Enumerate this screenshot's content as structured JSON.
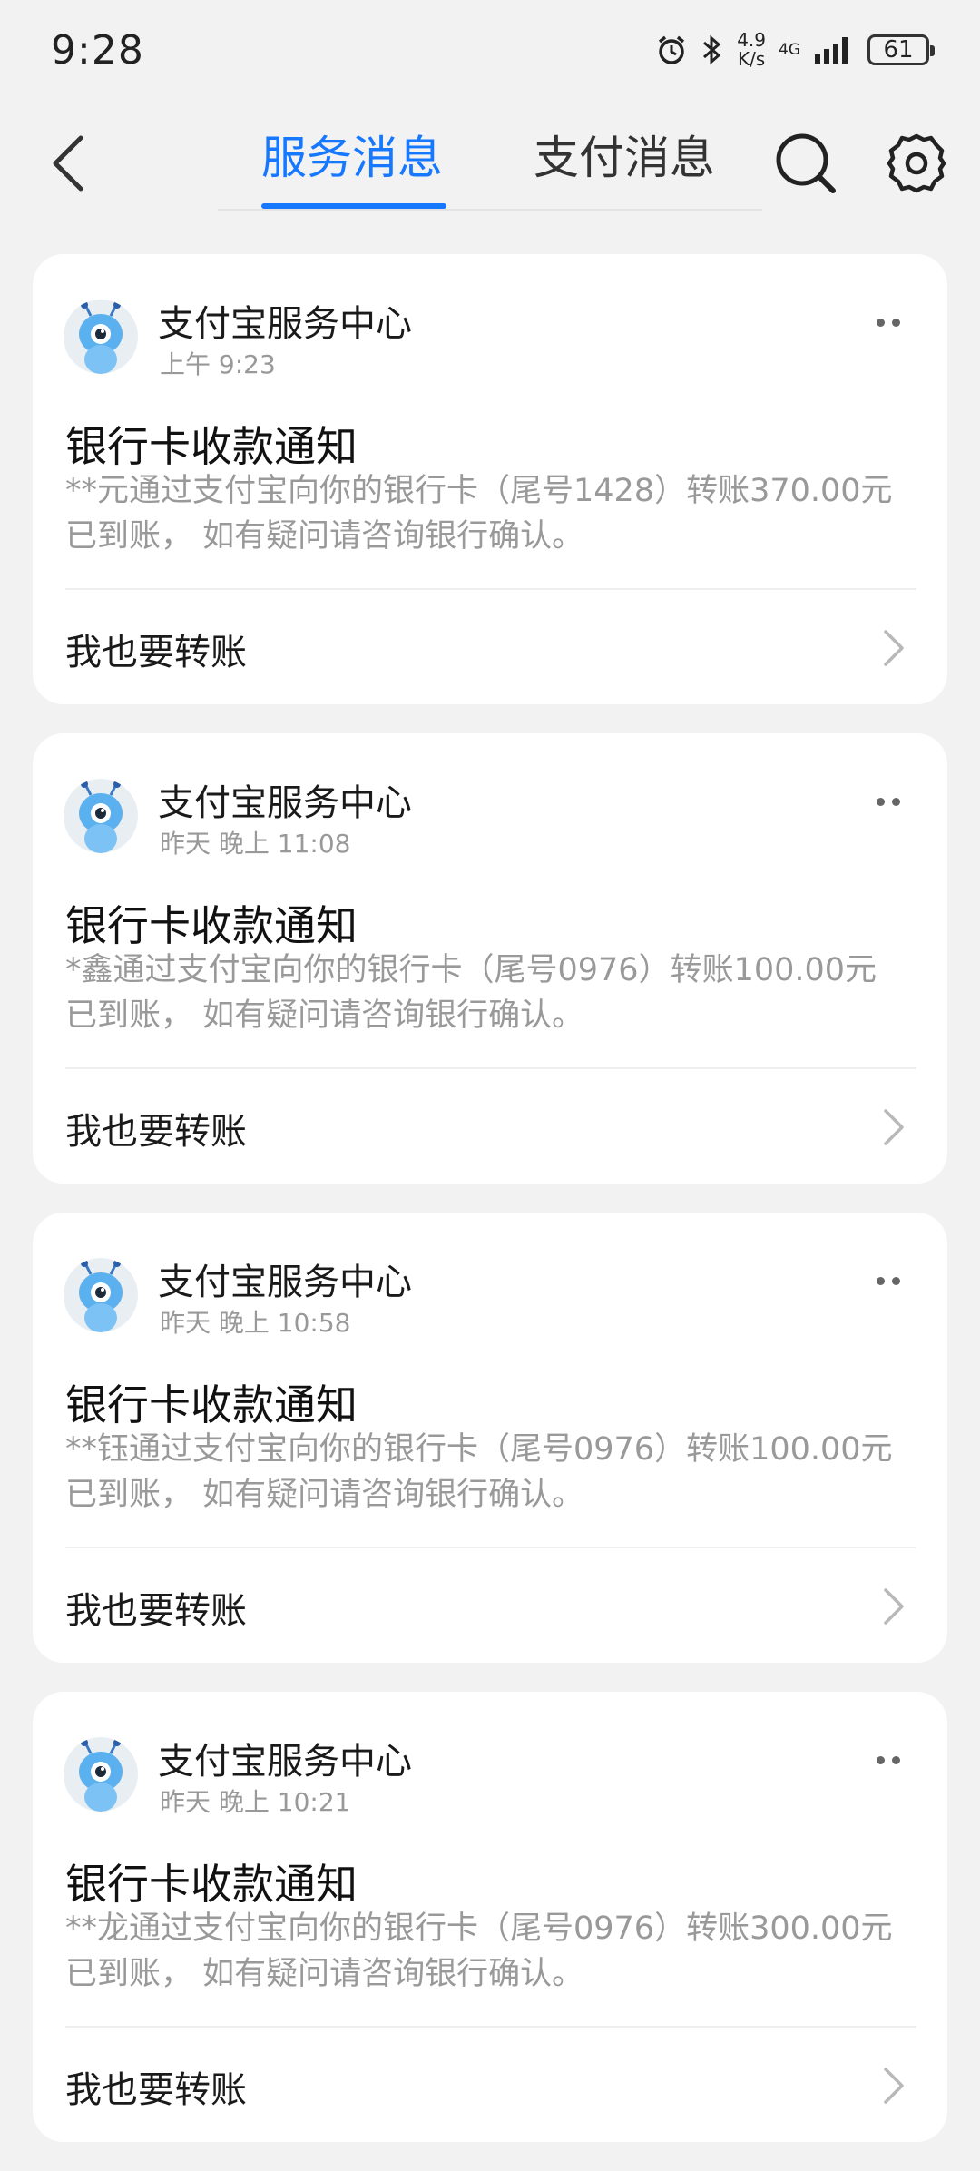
{
  "status": {
    "time": "9:28",
    "speed_top": "4.9",
    "speed_bottom": "K/s",
    "network": "4G",
    "battery": "61"
  },
  "header": {
    "tabs": [
      "服务消息",
      "支付消息"
    ],
    "active_tab": "服务消息",
    "accent_color": "#1677ff"
  },
  "messages": [
    {
      "sender": "支付宝服务中心",
      "time": "上午 9:23",
      "title": "银行卡收款通知",
      "body_line1": "**元通过支付宝向你的银行卡（尾号1428）转账370.00元",
      "body_line2": "已到账， 如有疑问请咨询银行确认。",
      "action": "我也要转账"
    },
    {
      "sender": "支付宝服务中心",
      "time": "昨天 晚上 11:08",
      "title": "银行卡收款通知",
      "body_line1": "*鑫通过支付宝向你的银行卡（尾号0976）转账100.00元",
      "body_line2": "已到账， 如有疑问请咨询银行确认。",
      "action": "我也要转账"
    },
    {
      "sender": "支付宝服务中心",
      "time": "昨天 晚上 10:58",
      "title": "银行卡收款通知",
      "body_line1": "**钰通过支付宝向你的银行卡（尾号0976）转账100.00元",
      "body_line2": "已到账， 如有疑问请咨询银行确认。",
      "action": "我也要转账"
    },
    {
      "sender": "支付宝服务中心",
      "time": "昨天 晚上 10:21",
      "title": "银行卡收款通知",
      "body_line1": "**龙通过支付宝向你的银行卡（尾号0976）转账300.00元",
      "body_line2": "已到账， 如有疑问请咨询银行确认。",
      "action": "我也要转账"
    }
  ],
  "icons": {
    "back": "back-arrow-icon",
    "search": "search-icon",
    "settings": "gear-icon",
    "more": "more-dots-icon",
    "chevron": "chevron-right-icon",
    "avatar": "ant-mascot-avatar"
  }
}
